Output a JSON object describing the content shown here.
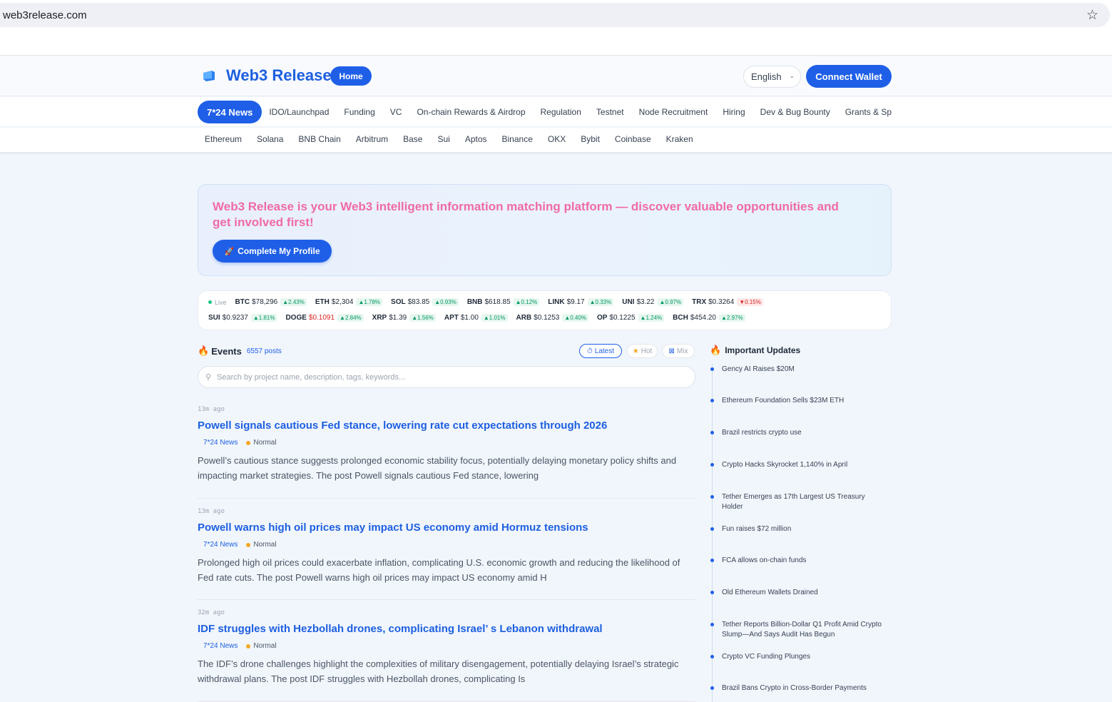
{
  "browser": {
    "url": "web3release.com"
  },
  "header": {
    "brand": "Web3 Release",
    "home_label": "Home",
    "language": "English",
    "connect_wallet": "Connect Wallet"
  },
  "nav_primary": {
    "active": "7*24 News",
    "items": [
      "IDO/Launchpad",
      "Funding",
      "VC",
      "On-chain Rewards & Airdrop",
      "Regulation",
      "Testnet",
      "Node Recruitment",
      "Hiring",
      "Dev & Bug Bounty",
      "Grants & Sp"
    ]
  },
  "nav_secondary": {
    "items": [
      "Ethereum",
      "Solana",
      "BNB Chain",
      "Arbitrum",
      "Base",
      "Sui",
      "Aptos",
      "Binance",
      "OKX",
      "Bybit",
      "Coinbase",
      "Kraken"
    ]
  },
  "hero": {
    "text": "Web3 Release is your Web3 intelligent information matching platform — discover valuable opportunities and get involved first!",
    "button": "Complete My Profile"
  },
  "ticker": {
    "live_label": "Live",
    "row1": [
      {
        "symbol": "BTC",
        "price": "$78,296",
        "change": "▲2.43%",
        "direction": "up",
        "price_color": "default"
      },
      {
        "symbol": "ETH",
        "price": "$2,304",
        "change": "▲1.78%",
        "direction": "up",
        "price_color": "default"
      },
      {
        "symbol": "SOL",
        "price": "$83.85",
        "change": "▲0.93%",
        "direction": "up",
        "price_color": "default"
      },
      {
        "symbol": "BNB",
        "price": "$618.85",
        "change": "▲0.12%",
        "direction": "up",
        "price_color": "default"
      },
      {
        "symbol": "LINK",
        "price": "$9.17",
        "change": "▲0.33%",
        "direction": "up",
        "price_color": "default"
      },
      {
        "symbol": "UNI",
        "price": "$3.22",
        "change": "▲0.97%",
        "direction": "up",
        "price_color": "default"
      },
      {
        "symbol": "TRX",
        "price": "$0.3264",
        "change": "▼0.15%",
        "direction": "down",
        "price_color": "default"
      }
    ],
    "row2": [
      {
        "symbol": "SUI",
        "price": "$0.9237",
        "change": "▲1.81%",
        "direction": "up",
        "price_color": "default"
      },
      {
        "symbol": "DOGE",
        "price": "$0.1091",
        "change": "▲2.84%",
        "direction": "up",
        "price_color": "red"
      },
      {
        "symbol": "XRP",
        "price": "$1.39",
        "change": "▲1.56%",
        "direction": "up",
        "price_color": "default"
      },
      {
        "symbol": "APT",
        "price": "$1.00",
        "change": "▲1.01%",
        "direction": "up",
        "price_color": "default"
      },
      {
        "symbol": "ARB",
        "price": "$0.1253",
        "change": "▲0.40%",
        "direction": "up",
        "price_color": "default"
      },
      {
        "symbol": "OP",
        "price": "$0.1225",
        "change": "▲1.24%",
        "direction": "up",
        "price_color": "default"
      },
      {
        "symbol": "BCH",
        "price": "$454.20",
        "change": "▲2.97%",
        "direction": "up",
        "price_color": "default"
      }
    ]
  },
  "events": {
    "title": "Events",
    "count": "6557 posts",
    "filters": {
      "latest": "Latest",
      "hot": "Hot",
      "mix": "Mix"
    },
    "search_placeholder": "Search by project name, description, tags, keywords...",
    "posts": [
      {
        "time": "13m ago",
        "title": "Powell signals cautious Fed stance, lowering rate cut expectations through 2026",
        "category": "7*24 News",
        "level": "Normal",
        "body": "Powell’s cautious stance suggests prolonged economic stability focus, potentially delaying monetary policy shifts and impacting market strategies. The post Powell signals cautious Fed stance, lowering"
      },
      {
        "time": "13m ago",
        "title": "Powell warns high oil prices may impact US economy amid Hormuz tensions",
        "category": "7*24 News",
        "level": "Normal",
        "body": "Prolonged high oil prices could exacerbate inflation, complicating U.S. economic growth and reducing the likelihood of Fed rate cuts. The post Powell warns high oil prices may impact US economy amid H"
      },
      {
        "time": "32m ago",
        "title": "IDF struggles with Hezbollah drones, complicating Israel’ s Lebanon withdrawal",
        "category": "7*24 News",
        "level": "Normal",
        "body": "The IDF’s drone challenges highlight the complexities of military disengagement, potentially delaying Israel’s strategic withdrawal plans. The post IDF struggles with Hezbollah drones, complicating Is"
      }
    ]
  },
  "updates": {
    "title": "Important Updates",
    "items": [
      "Gency AI Raises $20M",
      "Ethereum Foundation Sells $23M ETH",
      "Brazil restricts crypto use",
      "Crypto Hacks Skyrocket 1,140% in April",
      "Tether Emerges as 17th Largest US Treasury Holder",
      "Fun raises $72 million",
      "FCA allows on-chain funds",
      "Old Ethereum Wallets Drained",
      "Tether Reports Billion-Dollar Q1 Profit Amid Crypto Slump—And Says Audit Has Begun",
      "Crypto VC Funding Plunges",
      "Brazil Bans Crypto in Cross-Border Payments"
    ]
  },
  "colors": {
    "accent": "#1f5fe8",
    "hero_text": "#f06aa8",
    "up": "#059669",
    "down": "#dc2626",
    "level_normal": "#f5a623"
  },
  "icons": [
    "star-icon",
    "logo-icon",
    "chevron-down-icon",
    "rocket-icon",
    "fire-icon",
    "clock-icon",
    "star-filled-icon",
    "mix-icon",
    "search-icon"
  ]
}
